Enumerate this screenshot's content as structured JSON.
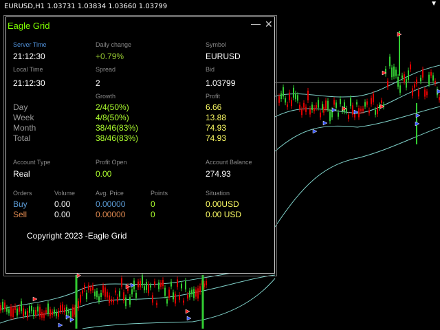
{
  "chart_header": "EURUSD,H1  1.03731 1.03834 1.03660 1.03799",
  "chart_corner_icon": "down-triangle",
  "panel": {
    "title": "Eagle Grid",
    "minimize_glyph": "—",
    "close_glyph": "✕",
    "server_time_label": "Server Time",
    "server_time": "21:12:30",
    "daily_change_label": "Daily change",
    "daily_change": "+0.79%",
    "symbol_label": "Symbol",
    "symbol": "EURUSD",
    "local_time_label": "Local Time",
    "local_time": "21:12:30",
    "spread_label": "Spread",
    "spread": "2",
    "bid_label": "Bid",
    "bid": "1.03799",
    "growth_label": "Growth",
    "profit_label": "Profit",
    "rows": [
      {
        "period": "Day",
        "growth": "2/4(50%)",
        "profit": "6.66"
      },
      {
        "period": "Week",
        "growth": "4/8(50%)",
        "profit": "13.88"
      },
      {
        "period": "Month",
        "growth": "38/46(83%)",
        "profit": "74.93"
      },
      {
        "period": "Total",
        "growth": "38/46(83%)",
        "profit": "74.93"
      }
    ],
    "account_type_label": "Account Type",
    "account_type": "Real",
    "profit_open_label": "Profit Open",
    "profit_open": "0.00",
    "account_balance_label": "Account Balance",
    "account_balance": "274.93",
    "orders_label": "Orders",
    "volume_label": "Volume",
    "avg_price_label": "Avg. Price",
    "points_label": "Points",
    "situation_label": "Situation",
    "buy": {
      "label": "Buy",
      "volume": "0.00",
      "avg_price": "0.00000",
      "points": "0",
      "situation": "0.00USD"
    },
    "sell": {
      "label": "Sell",
      "volume": "0.00",
      "avg_price": "0.00000",
      "points": "0",
      "situation": "0.00 USD"
    },
    "copyright": "Copyright 2023 -Eagle Grid"
  }
}
